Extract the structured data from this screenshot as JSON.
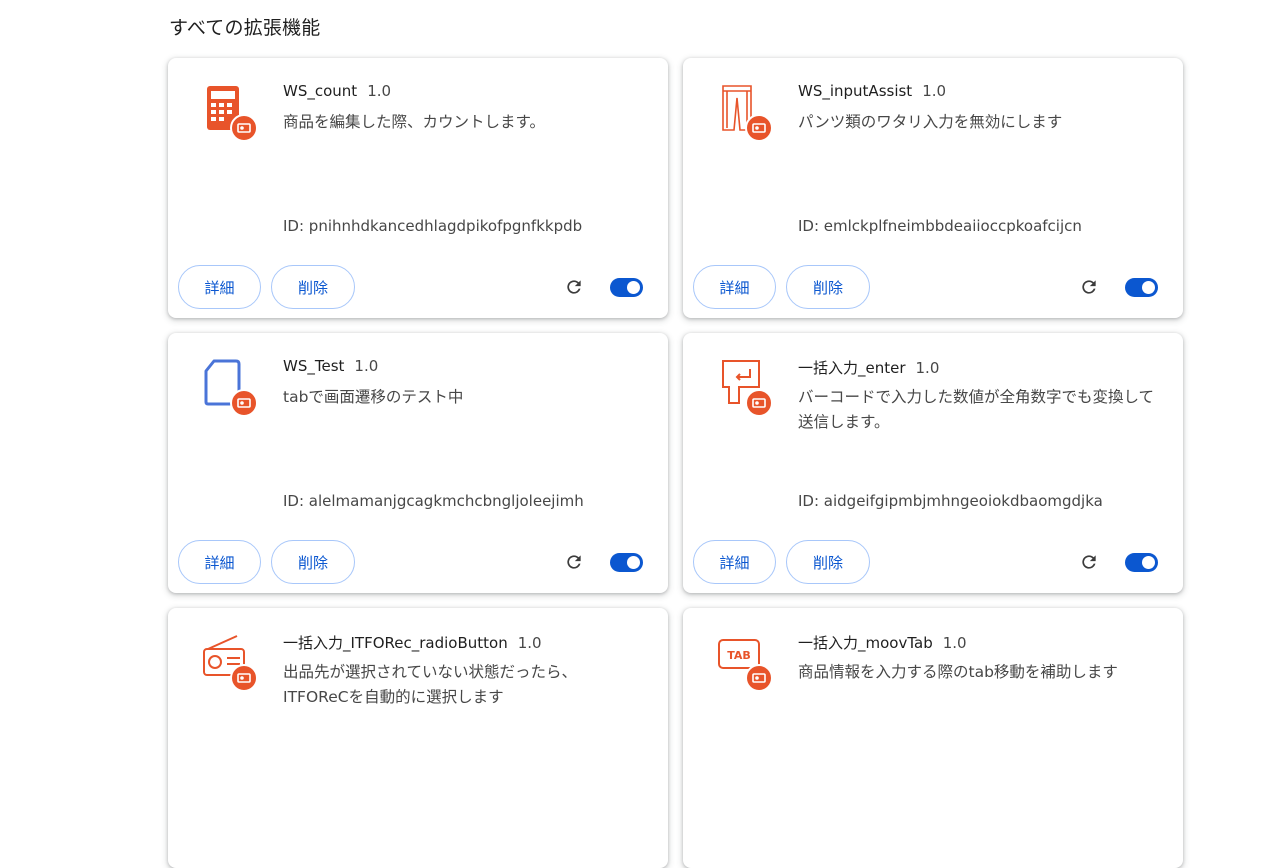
{
  "section_title": "すべての拡張機能",
  "common": {
    "details_label": "詳細",
    "remove_label": "削除"
  },
  "extensions": [
    {
      "name": "WS_count",
      "version": "1.0",
      "description": "商品を編集した際、カウントします。",
      "id": "ID: pnihnhdkancedhlagdpikofpgnfkkpdb",
      "icon": "calculator-icon",
      "enabled": true
    },
    {
      "name": "WS_inputAssist",
      "version": "1.0",
      "description": "パンツ類のワタリ入力を無効にします",
      "id": "ID: emlckplfneimbbdeaiioccpkoafcijcn",
      "icon": "pants-icon",
      "enabled": true
    },
    {
      "name": "WS_Test",
      "version": "1.0",
      "description": "tabで画面遷移のテスト中",
      "id": "ID: alelmamanjgcagkmchcbngljoleejimh",
      "icon": "document-icon",
      "enabled": true
    },
    {
      "name": "一括入力_enter",
      "version": "1.0",
      "description": "バーコードで入力した数値が全角数字でも変換して送信します。",
      "id": "ID: aidgeifgipmbjmhngeoiokdbaomgdjka",
      "icon": "enter-key-icon",
      "enabled": true
    },
    {
      "name": "一括入力_ITFORec_radioButton",
      "version": "1.0",
      "description": "出品先が選択されていない状態だったら、ITFOReCを自動的に選択します",
      "icon": "radio-icon"
    },
    {
      "name": "一括入力_moovTab",
      "version": "1.0",
      "description": "商品情報を入力する際のtab移動を補助します",
      "icon": "tab-key-icon",
      "tab_icon_text": "TAB"
    }
  ],
  "colors": {
    "accent": "#0b57d0",
    "icon_orange": "#e8542a",
    "icon_blue": "#4a74d8"
  }
}
